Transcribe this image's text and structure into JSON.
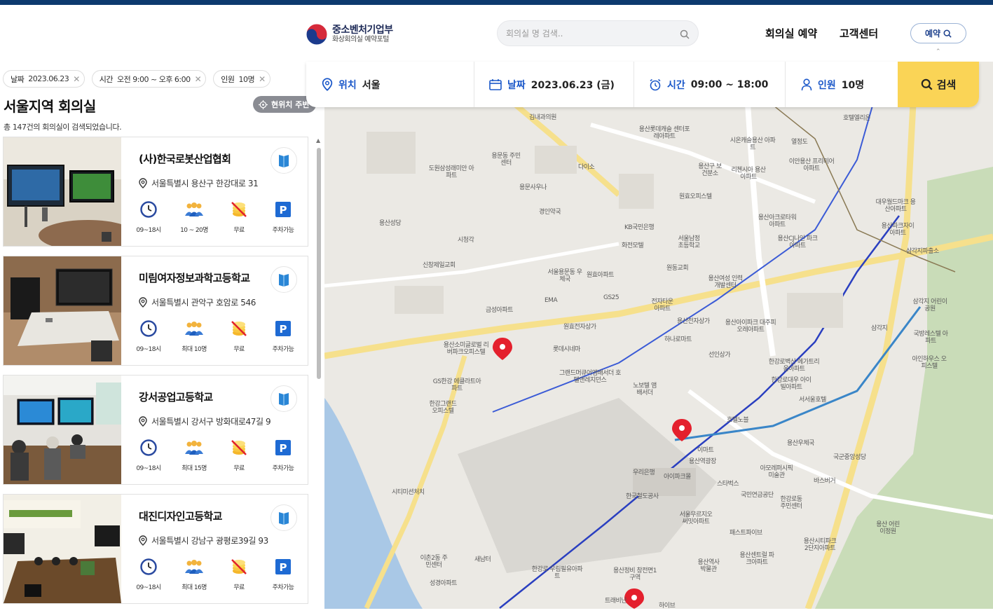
{
  "header": {
    "logo_line1": "중소벤처기업부",
    "logo_line2": "화상회의실 예약포털",
    "search_placeholder": "회의실 명 검색..",
    "nav": [
      "회의실 예약",
      "고객센터"
    ],
    "reserve_label": "예약"
  },
  "filters": {
    "chips": [
      {
        "key": "날짜",
        "value": "2023.06.23"
      },
      {
        "key": "시간",
        "value": "오전 9:00 ~ 오후 6:00"
      },
      {
        "key": "인원",
        "value": "10명"
      }
    ]
  },
  "list": {
    "title": "서울지역 회의실",
    "near_label": "현위치 주변",
    "count_text": "총 147건의 회의실이 검색되었습니다.",
    "rooms": [
      {
        "name": "(사)한국로봇산업협회",
        "address": "서울특별시 용산구 한강대로 31",
        "hours": "09~18시",
        "capacity": "10 ~ 20명",
        "fee": "무료",
        "parking": "주차가능"
      },
      {
        "name": "미림여자정보과학고등학교",
        "address": "서울특별시 관악구 호암로 546",
        "hours": "09~18시",
        "capacity": "최대 10명",
        "fee": "무료",
        "parking": "주차가능"
      },
      {
        "name": "강서공업고등학교",
        "address": "서울특별시 강서구 방화대로47길 9",
        "hours": "09~18시",
        "capacity": "최대 15명",
        "fee": "무료",
        "parking": "주차가능"
      },
      {
        "name": "대진디자인고등학교",
        "address": "서울특별시 강남구 광평로39길 93",
        "hours": "09~18시",
        "capacity": "최대 16명",
        "fee": "무료",
        "parking": "주차가능"
      }
    ]
  },
  "searchbar": {
    "location_key": "위치",
    "location_value": "서울",
    "date_key": "날짜",
    "date_value": "2023.06.23 (금)",
    "time_key": "시간",
    "time_value": "09:00 ~ 18:00",
    "people_key": "인원",
    "people_value": "10명",
    "search_label": "검색"
  },
  "map": {
    "labels": [
      "김내과의원",
      "용산롯데캐슬 센터포레아파트",
      "시온캐슬용산 아파트",
      "열정도",
      "호텔엘리온",
      "도원삼성래미안 아파트",
      "다이소",
      "용산구 보건분소",
      "리첸시아 용산아파트",
      "이안용산 프리미어아파트",
      "원효오피스텔",
      "용문동 주민센터",
      "용문사우나",
      "경인약국",
      "용산성당",
      "시청각",
      "KB국민은행",
      "화전모텔",
      "서울남정 초등학교",
      "용산아크로타워 아파트",
      "용산CJ나인 파크아파트",
      "대우월드마크 용산아파트",
      "용산파크자이 아파트",
      "신창제일교회",
      "서울용문동 우체국",
      "원효아파트",
      "원동교회",
      "용산여성 인력개발센터",
      "삼각지파출소",
      "EMA",
      "GS25",
      "전자타운 아파트",
      "용산전자상가",
      "용산아이파크 대주피오레아파트",
      "원효전자상가",
      "금성아파트",
      "롯데시네마",
      "하나로마트",
      "선인상가",
      "용산소미글로벌 리버파크오피스텔",
      "그랜드머큐어앰배서더 호텔앤레지던스",
      "노보텔 앰배서더",
      "한강로벽산 메가트리움아파트",
      "한강로대우 아이빌아파트",
      "서서울호텔",
      "국방레스텔 아파트",
      "아인하우스 오피스텔",
      "GS한강 에클라트아파트",
      "한강그랜드 오피스텔",
      "호텔노블",
      "이마트",
      "용산역광장",
      "아이파크몰",
      "스타벅스",
      "국민연금공단",
      "한강로동 주민센터",
      "우리은행",
      "용산우체국",
      "아모레퍼시픽 미술관",
      "바스버거",
      "국군중앙성당",
      "한국철도공사",
      "서울무르지오 써밋아파트",
      "용산역사 박물관",
      "용산센트럴 파크아파트",
      "용산시티파크 2단지아파트",
      "용산 어린이정원",
      "한강로 우림필유아파트",
      "이촌2동 주민센터",
      "새남터",
      "시티미션처치",
      "성경아파트",
      "삼각지 어린이공원",
      "패스트파이브",
      "용산정비 창전면1구역",
      "트래비난",
      "하이브",
      "삼각지"
    ]
  }
}
